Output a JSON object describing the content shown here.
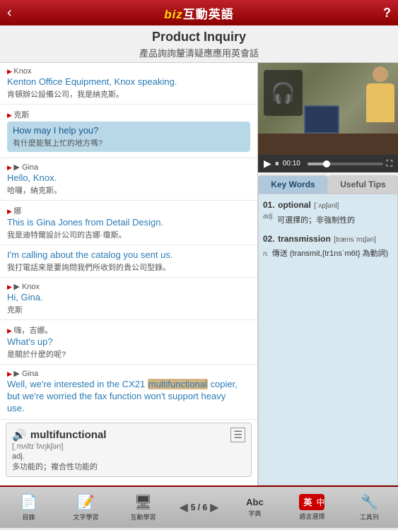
{
  "topbar": {
    "title_biz": "biz",
    "title_rest": "互動英語",
    "help_label": "?",
    "back_label": "‹"
  },
  "page_title": {
    "en": "Product Inquiry",
    "zh": "產品詢詢釐清疑應應用英會話"
  },
  "dialogue": [
    {
      "speaker_en": "Knox",
      "speaker_zh": "克斯",
      "en_text": "Kenton Office Equipment, Knox speaking.",
      "zh_text": "肯頓辦公設備公司，我是納克斯。",
      "highlight": false
    },
    {
      "speaker_en": "",
      "speaker_zh": "",
      "en_text": "How may I help you?",
      "zh_text": "有什麼能幫上忙的地方嗎?",
      "highlight": true
    },
    {
      "speaker_en": "Gina",
      "speaker_zh": "娜",
      "en_text": "Hello, Knox.",
      "zh_text": "哈囉，納克斯。",
      "highlight": false
    },
    {
      "speaker_en": "",
      "speaker_zh": "",
      "en_text": "This is Gina Jones from Detail Design.",
      "zh_text": "我是迪特爾設計公司的吉娜·瓊斯。",
      "highlight": false
    },
    {
      "speaker_en": "",
      "speaker_zh": "",
      "en_text": "I'm calling about the catalog you sent us.",
      "zh_text": "我打電話來是要詢問我們所收到的貴公司型錄。",
      "highlight": false
    },
    {
      "speaker_en": "Knox",
      "speaker_zh": "克斯",
      "en_text": "Hi, Gina.",
      "zh_text": "嗨，吉娜。",
      "highlight": false
    },
    {
      "speaker_en": "",
      "speaker_zh": "",
      "en_text": "What's up?",
      "zh_text": "是關於什麼的呢?",
      "highlight": false
    },
    {
      "speaker_en": "Gina",
      "speaker_zh": "",
      "en_text_parts": [
        "Well, we're interested in the CX21 ",
        "multifunctional",
        " copier,"
      ],
      "en_text_line2": "but we're worried the fax function won't support heavy",
      "en_text_line3": "use.",
      "zh_text": "",
      "highlight": false,
      "has_highlight_word": true
    }
  ],
  "word_popup": {
    "word": "multifunctional",
    "phonetic": "[ˌmʌltɪˈfʌŋkʃən]",
    "pos": "adj.",
    "definition": "多功能的；複合性功能的"
  },
  "video": {
    "time": "00:10",
    "progress_percent": 30
  },
  "keywords_tab": {
    "active": "Key Words",
    "inactive": "Useful Tips",
    "items": [
      {
        "number": "01.",
        "word": "optional",
        "phonetic": "[ˈʌpʃənl]",
        "pos": "adj.",
        "definition": "可選擇的；非強制性的"
      },
      {
        "number": "02.",
        "word": "transmission",
        "phonetic": "[trænsˈmɪʃən]",
        "pos": "n.",
        "definition": "傳送 (transmit,{tr1nsˈm6t} 為動詞)"
      }
    ]
  },
  "bottom_nav": {
    "items": [
      {
        "label": "目錄",
        "icon": "📄",
        "active": true
      },
      {
        "label": "文字學習",
        "icon": "📝",
        "active": false
      },
      {
        "label": "互動學習",
        "icon": "🖥",
        "active": false
      }
    ],
    "page": {
      "current": "5",
      "total": "6"
    },
    "dict_label": "字典",
    "dict_icon": "Abc",
    "lang_en": "英",
    "lang_zh": "中",
    "tools_label": "工具列",
    "tools_icon": "🔧"
  }
}
